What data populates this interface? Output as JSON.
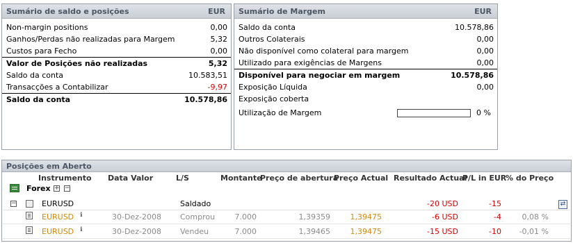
{
  "balance": {
    "title": "Sumário de saldo e posições",
    "currency": "EUR",
    "rows": [
      {
        "label": "Non-margin positions",
        "value": "0,00",
        "bold": false,
        "neg": false,
        "sep": false
      },
      {
        "label": "Ganhos/Perdas não realizadas para Margem",
        "value": "5,32",
        "bold": false,
        "neg": false,
        "sep": false
      },
      {
        "label": "Custos para Fecho",
        "value": "0,00",
        "bold": false,
        "neg": false,
        "sep": false
      },
      {
        "label": "Valor de Posições não realizadas",
        "value": "5,32",
        "bold": true,
        "neg": false,
        "sep": true
      },
      {
        "label": "Saldo da conta",
        "value": "10.583,51",
        "bold": false,
        "neg": false,
        "sep": false
      },
      {
        "label": "Transacções a Contabilizar",
        "value": "-9,97",
        "bold": false,
        "neg": true,
        "sep": false
      },
      {
        "label": "Saldo da conta",
        "value": "10.578,86",
        "bold": true,
        "neg": false,
        "sep": true
      }
    ]
  },
  "margin": {
    "title": "Sumário de Margem",
    "currency": "EUR",
    "rows": [
      {
        "label": "Saldo da conta",
        "value": "10.578,86",
        "bold": false,
        "sep": false
      },
      {
        "label": "Outros Colaterais",
        "value": "0,00",
        "bold": false,
        "sep": false
      },
      {
        "label": "Não disponível como colateral para margem",
        "value": "0,00",
        "bold": false,
        "sep": false
      },
      {
        "label": "Utilizado para exigências de Margens",
        "value": "0,00",
        "bold": false,
        "sep": false
      },
      {
        "label": "Disponível para negociar em margem",
        "value": "10.578,86",
        "bold": true,
        "sep": true
      },
      {
        "label": "Exposição Líquida",
        "value": "0,00",
        "bold": false,
        "sep": false
      },
      {
        "label": "Exposição coberta",
        "value": "",
        "bold": false,
        "sep": false
      }
    ],
    "utilization_label": "Utilização de Margem",
    "utilization_value": "0 %",
    "utilization_fraction": 0
  },
  "positions": {
    "title": "Posições em Aberto",
    "headers": {
      "instrument": "Instrumento",
      "date": "Data Valor",
      "ls": "L/S",
      "amount": "Montante",
      "open_price": "Preço de abertura",
      "current_price": "Preço Actual",
      "result": "Resultado Actual",
      "pl": "P/L in EUR",
      "pct": "% do Preço"
    },
    "group": "Forex",
    "group_expand": "+",
    "group_collapse": "−",
    "summary": {
      "collapse": "−",
      "instrument": "EURUSD",
      "ls": "Saldado",
      "result": "-20 USD",
      "pl": "-15"
    },
    "trades": [
      {
        "instrument": "EURUSD",
        "date": "30-Dez-2008",
        "ls": "Comprou",
        "amount": "7.000",
        "open_price": "1,39359",
        "current_price": "1,39475",
        "result": "-6 USD",
        "pl": "-4",
        "pct": "0,08 %"
      },
      {
        "instrument": "EURUSD",
        "date": "30-Dez-2008",
        "ls": "Vendeu",
        "amount": "7.000",
        "open_price": "1,39465",
        "current_price": "1,39475",
        "result": "-15 USD",
        "pl": "-10",
        "pct": "-0,01 %"
      }
    ],
    "info_glyph": "ℹ"
  },
  "colors": {
    "negative": "#d20000",
    "instrument_link": "#d08a0a",
    "header_bg": "#d3d8de"
  }
}
